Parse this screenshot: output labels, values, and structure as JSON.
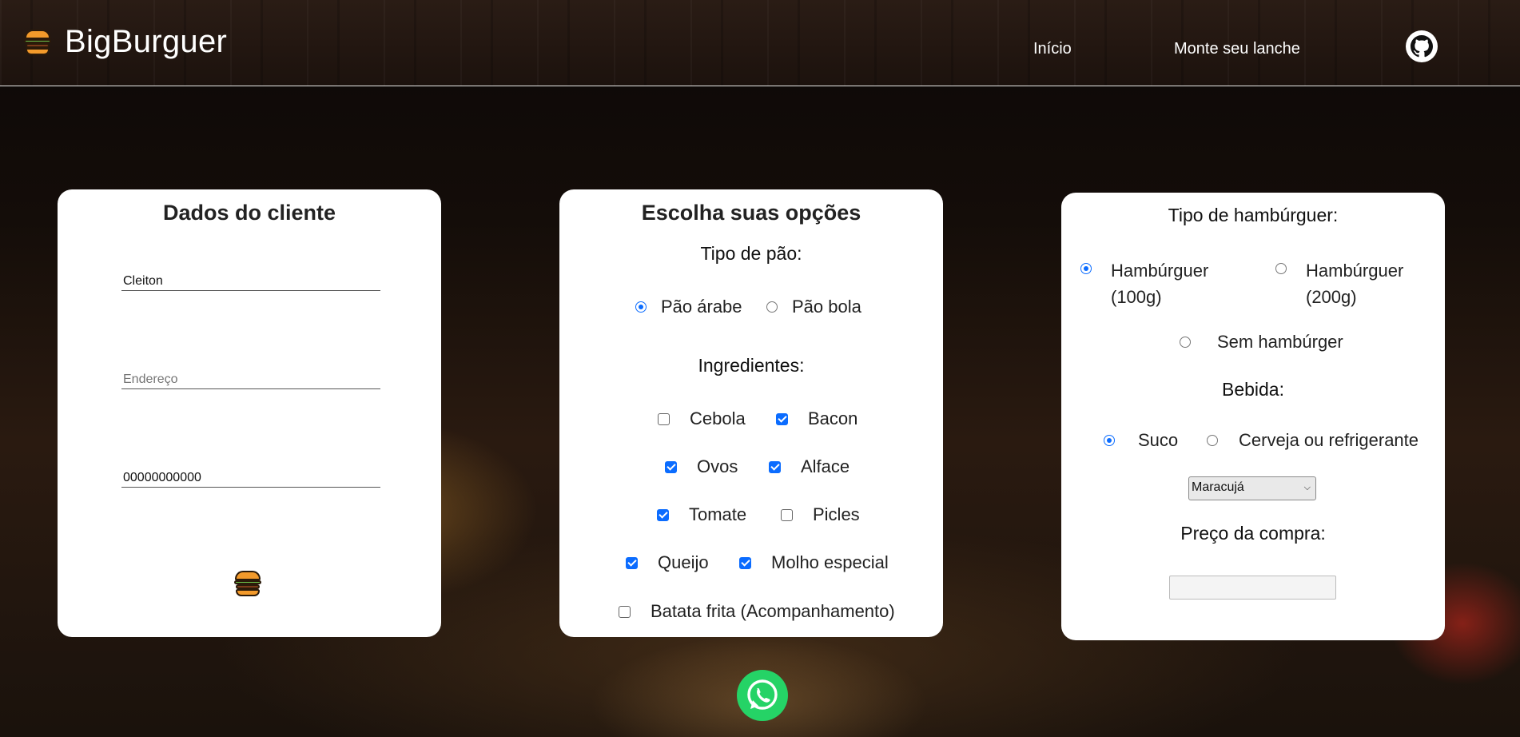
{
  "header": {
    "brand": "BigBurguer",
    "nav": [
      "Início",
      "Monte seu lanche"
    ]
  },
  "client": {
    "title": "Dados do cliente",
    "name_value": "Cleiton",
    "address_placeholder": "Endereço",
    "phone_value": "00000000000"
  },
  "options": {
    "title": "Escolha suas opções",
    "bread_label": "Tipo de pão:",
    "breads": [
      {
        "label": "Pão árabe",
        "checked": true
      },
      {
        "label": "Pão bola",
        "checked": false
      }
    ],
    "ingredients_label": "Ingredientes:",
    "ingredients": [
      {
        "label": "Cebola",
        "checked": false
      },
      {
        "label": "Bacon",
        "checked": true
      },
      {
        "label": "Ovos",
        "checked": true
      },
      {
        "label": "Alface",
        "checked": true
      },
      {
        "label": "Tomate",
        "checked": true
      },
      {
        "label": "Picles",
        "checked": false
      },
      {
        "label": "Queijo",
        "checked": true
      },
      {
        "label": "Molho especial",
        "checked": true
      },
      {
        "label": "Batata frita (Acompanhamento)",
        "checked": false
      }
    ]
  },
  "order": {
    "burger_label": "Tipo de hambúrguer:",
    "burgers": [
      {
        "line1": "Hambúrguer",
        "line2": "(100g)",
        "checked": true
      },
      {
        "line1": "Hambúrguer",
        "line2": "(200g)",
        "checked": false
      },
      {
        "line1": "Sem hambúrger",
        "line2": "",
        "checked": false
      }
    ],
    "drink_label": "Bebida:",
    "drinks": [
      {
        "label": "Suco",
        "checked": true
      },
      {
        "label": "Cerveja ou refrigerante",
        "checked": false
      }
    ],
    "juice_selected": "Maracujá",
    "price_label": "Preço da compra:",
    "price_value": ""
  },
  "icons": {
    "brand": "burger-icon",
    "github": "github-icon",
    "submit": "burger-icon",
    "whatsapp": "whatsapp-icon"
  },
  "colors": {
    "accent": "#0b6cff",
    "whatsapp": "#25d366",
    "burger_bun": "#f39a2b"
  }
}
